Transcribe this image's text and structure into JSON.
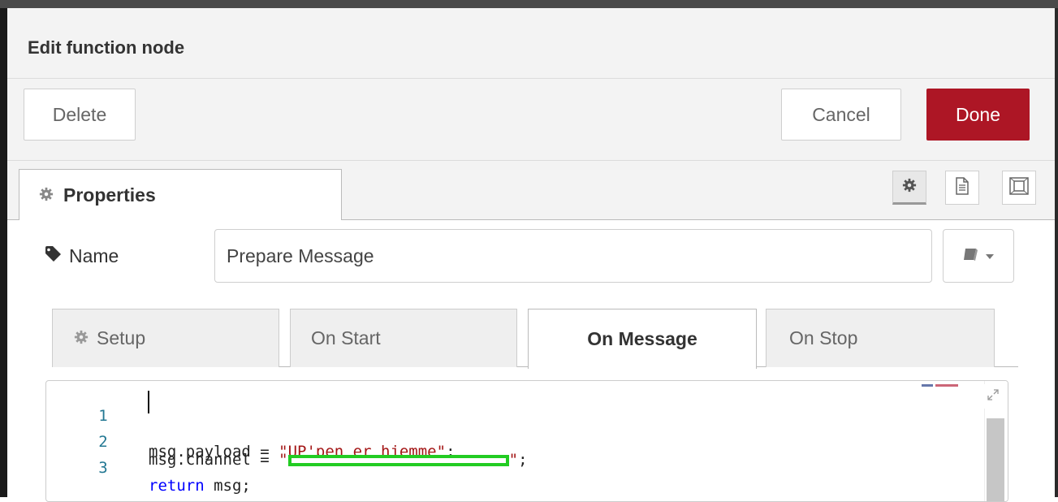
{
  "dialog": {
    "title": "Edit function node"
  },
  "toolbar": {
    "delete_label": "Delete",
    "cancel_label": "Cancel",
    "done_label": "Done",
    "done_color": "#ad1625"
  },
  "tabs": {
    "properties_label": "Properties",
    "icons": [
      "gear-icon",
      "document-icon",
      "frame-icon"
    ]
  },
  "name_field": {
    "label": "Name",
    "value": "Prepare Message"
  },
  "subtabs": [
    {
      "label": "Setup",
      "icon": "gear-icon",
      "active": false
    },
    {
      "label": "On Start",
      "active": false
    },
    {
      "label": "On Message",
      "active": true
    },
    {
      "label": "On Stop",
      "active": false
    }
  ],
  "editor": {
    "lines": [
      {
        "number": "1",
        "code_a": "msg.payload = ",
        "string": "\"UP'pen er hjemme\"",
        "code_b": ";"
      },
      {
        "number": "2",
        "code_a": "msg.channel = ",
        "string_open": "\"",
        "string_close": "\"",
        "code_b": ";"
      },
      {
        "number": "3",
        "keyword": "return",
        "code_a": " msg;"
      }
    ]
  }
}
